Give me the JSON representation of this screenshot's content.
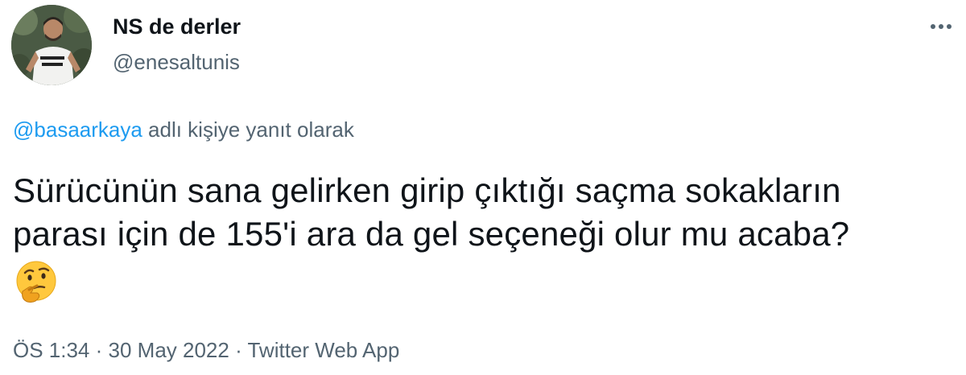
{
  "author": {
    "display_name": "NS de derler",
    "handle": "@enesaltunis"
  },
  "reply_context": {
    "mention": "@basaarkaya",
    "suffix": " adlı kişiye yanıt olarak"
  },
  "tweet": {
    "lines": [
      "Sürücünün sana gelirken girip çıktığı saçma sokakların",
      "parası için de 155'i ara da gel seçeneği olur mu acaba?"
    ],
    "emoji": "thinking-face"
  },
  "meta": {
    "time": "ÖS 1:34",
    "separator": " · ",
    "date": "30 May 2022",
    "source": "Twitter Web App"
  },
  "icons": {
    "more": "more-horizontal-icon"
  },
  "colors": {
    "text_primary": "#0f1419",
    "text_secondary": "#536471",
    "link": "#1d9bf0",
    "background": "#ffffff"
  }
}
